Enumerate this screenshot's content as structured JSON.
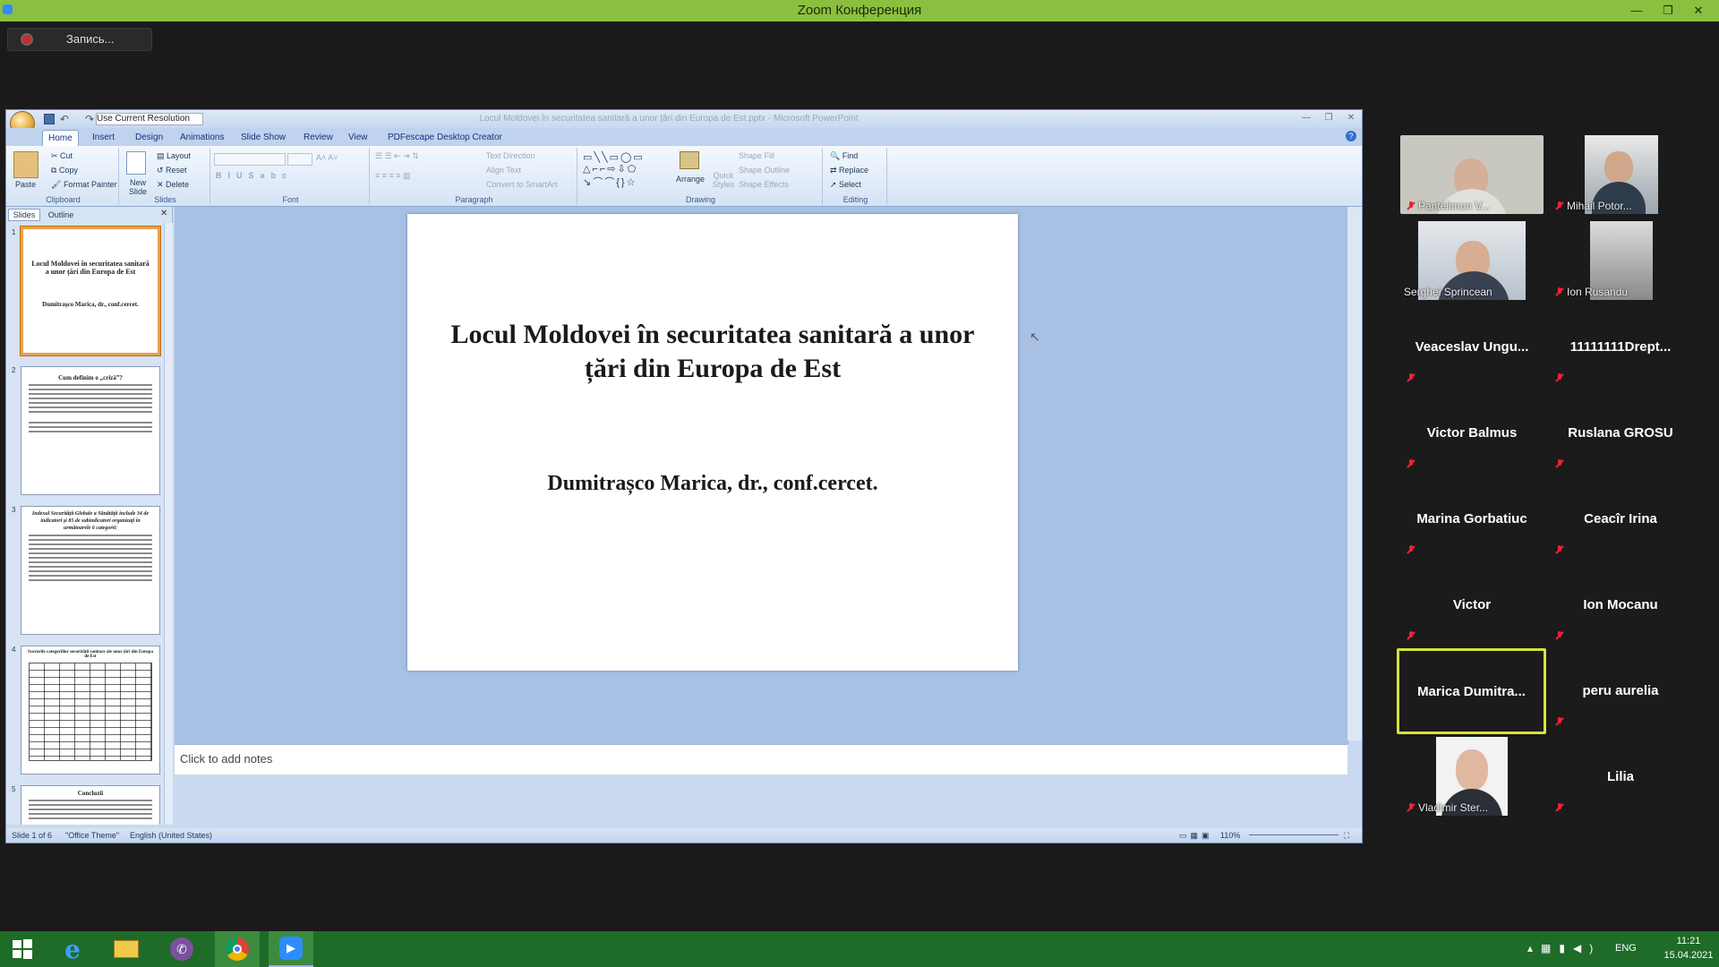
{
  "zoom": {
    "title": "Zoom Конференция",
    "record_label": "Запись...",
    "participants": [
      {
        "name": "Pantelimon V...",
        "video": true,
        "muted": true
      },
      {
        "name": "Mihail Potor...",
        "video": true,
        "muted": true
      },
      {
        "name": "Serghei Sprincean",
        "video": true,
        "muted": false
      },
      {
        "name": "Ion Rusandu",
        "video": true,
        "muted": true
      },
      {
        "name": "Veaceslav  Ungu...",
        "video": false,
        "muted": true
      },
      {
        "name": "11111111Drept...",
        "video": false,
        "muted": true
      },
      {
        "name": "Victor Balmus",
        "video": false,
        "muted": true
      },
      {
        "name": "Ruslana GROSU",
        "video": false,
        "muted": true
      },
      {
        "name": "Marina Gorbatiuc",
        "video": false,
        "muted": true
      },
      {
        "name": "Ceacîr Irina",
        "video": false,
        "muted": true
      },
      {
        "name": "Victor",
        "video": false,
        "muted": true
      },
      {
        "name": "Ion Mocanu",
        "video": false,
        "muted": true
      },
      {
        "name": "Marica  Dumitra...",
        "video": false,
        "muted": false,
        "active": true
      },
      {
        "name": "peru aurelia",
        "video": false,
        "muted": true
      },
      {
        "name": "Vladimir Ster...",
        "video": true,
        "muted": true
      },
      {
        "name": "Lilia",
        "video": false,
        "muted": true
      }
    ]
  },
  "ppt": {
    "doc_title": "Locul Moldovei în securitatea sanitară a unor țări din Europa de Est.pptx - Microsoft PowerPoint",
    "qat_resolution": "Use Current Resolution",
    "tabs": [
      "Home",
      "Insert",
      "Design",
      "Animations",
      "Slide Show",
      "Review",
      "View",
      "PDFescape Desktop Creator"
    ],
    "ribbon": {
      "clipboard": {
        "label": "Clipboard",
        "paste": "Paste",
        "cut": "Cut",
        "copy": "Copy",
        "format_painter": "Format Painter"
      },
      "slides": {
        "label": "Slides",
        "new_slide": "New Slide",
        "layout": "Layout",
        "reset": "Reset",
        "delete": "Delete"
      },
      "font": {
        "label": "Font"
      },
      "paragraph": {
        "label": "Paragraph",
        "text_direction": "Text Direction",
        "align_text": "Align Text",
        "convert": "Convert to SmartArt"
      },
      "drawing": {
        "label": "Drawing",
        "arrange": "Arrange",
        "quick_styles": "Quick Styles",
        "shape_fill": "Shape Fill",
        "shape_outline": "Shape Outline",
        "shape_effects": "Shape Effects"
      },
      "editing": {
        "label": "Editing",
        "find": "Find",
        "replace": "Replace",
        "select": "Select"
      }
    },
    "panel": {
      "slides_tab": "Slides",
      "outline_tab": "Outline"
    },
    "thumbnails": [
      {
        "num": "1",
        "title": "Locul Moldovei în securitatea sanitară a unor țări din Europa de Est",
        "sub": "Dumitrașco Marica, dr., conf.cercet."
      },
      {
        "num": "2",
        "title": "Cum definim o „criză”?",
        "sub": ""
      },
      {
        "num": "3",
        "title": "Indexul Securității Globale a Sănătății include 34 de indicatori și 85 de subindicatori organizați în următoarele 6 categorii:",
        "sub": ""
      },
      {
        "num": "4",
        "title": "Scorurile categoriilor securității sanitare ale unor țări din Europa de Est",
        "sub": ""
      },
      {
        "num": "5",
        "title": "Concluzii",
        "sub": ""
      }
    ],
    "slide": {
      "title": "Locul Moldovei în securitatea sanitară a unor țări din Europa de Est",
      "author": "Dumitrașco Marica, dr., conf.cercet."
    },
    "notes_placeholder": "Click to add notes",
    "status": {
      "slide": "Slide 1 of 6",
      "theme": "\"Office Theme\"",
      "language": "English (United States)",
      "zoom": "110%"
    }
  },
  "taskbar": {
    "lang": "ENG",
    "time": "11:21",
    "date": "15.04.2021"
  }
}
